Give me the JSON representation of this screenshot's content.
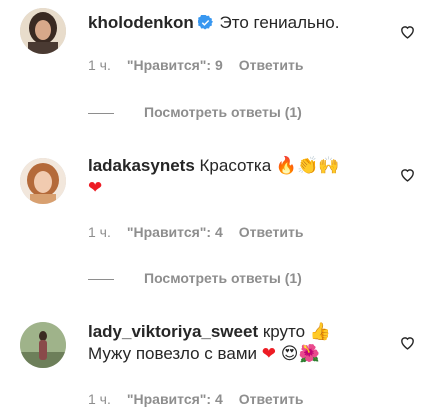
{
  "comments": [
    {
      "username": "kholodenkon",
      "verified": true,
      "text": "Это гениально.",
      "time": "1 ч.",
      "likes_label": "\"Нравится\": 9",
      "reply_label": "Ответить",
      "view_replies": "Посмотреть ответы (1)"
    },
    {
      "username": "ladakasynets",
      "verified": false,
      "text": "Красотка",
      "emoji": "🔥👏🙌",
      "emoji2": "❤",
      "time": "1 ч.",
      "likes_label": "\"Нравится\": 4",
      "reply_label": "Ответить",
      "view_replies": "Посмотреть ответы (1)"
    },
    {
      "username": "lady_viktoriya_sweet",
      "verified": false,
      "text": "круто",
      "emoji": "👍",
      "text2": "Мужу повезло с вами",
      "emoji2": "❤",
      "emoji3": "😍🌺",
      "time": "1 ч.",
      "likes_label": "\"Нравится\": 4",
      "reply_label": "Ответить"
    }
  ],
  "icons": {
    "like": "heart-outline-icon",
    "verified": "verified-badge-icon"
  },
  "colors": {
    "muted": "#8e8e8e",
    "verified": "#3897f0",
    "heart": "#ed1c24"
  }
}
